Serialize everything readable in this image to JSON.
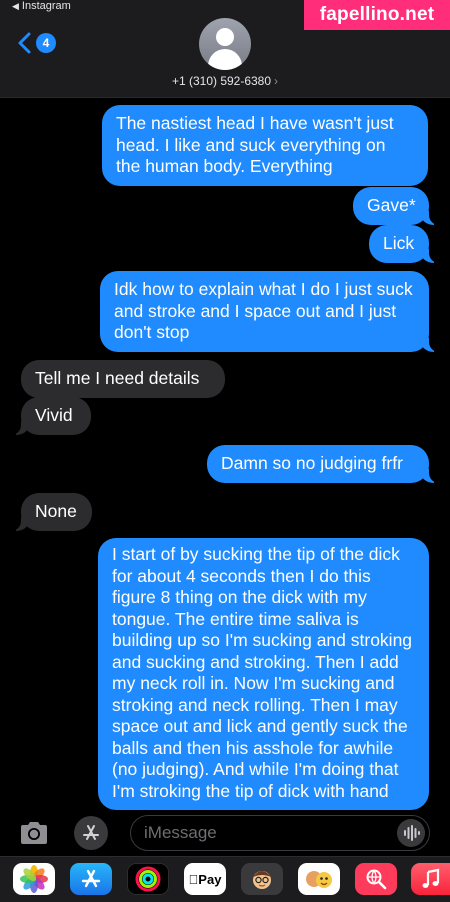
{
  "status_bar": {
    "back_app": "Instagram"
  },
  "header": {
    "back_count": "4",
    "contact_name": "+1 (310) 592-6380",
    "watermark": "fapellino.net"
  },
  "messages": [
    {
      "direction": "outgoing",
      "text": "The nastiest head I have wasn't just head. I like and suck everything on the human body. Everything"
    },
    {
      "direction": "outgoing",
      "text": "Gave*"
    },
    {
      "direction": "outgoing",
      "text": "Lick"
    },
    {
      "direction": "outgoing",
      "text": "Idk how to explain what I do I just suck and stroke and I space out and I just don't stop"
    },
    {
      "direction": "incoming",
      "text": "Tell me I need details"
    },
    {
      "direction": "incoming",
      "text": "Vivid"
    },
    {
      "direction": "outgoing",
      "text": "Damn so no judging frfr"
    },
    {
      "direction": "incoming",
      "text": "None"
    },
    {
      "direction": "outgoing",
      "text": "I start of by sucking the tip of the dick for about 4 seconds then I do this figure 8 thing on the dick with my tongue. The entire time saliva is building up so I'm sucking and stroking and sucking and stroking. Then I add my neck roll in. Now I'm sucking and stroking and neck rolling. Then I may space out and lick and gently suck the balls and then his asshole for awhile (no judging). And while I'm doing that I'm stroking the tip of dick with hand"
    }
  ],
  "input": {
    "placeholder": "iMessage"
  },
  "app_strip": [
    {
      "name": "photos",
      "icon": "photos-icon"
    },
    {
      "name": "app-store",
      "icon": "app-store-icon"
    },
    {
      "name": "activity",
      "icon": "activity-rings-icon"
    },
    {
      "name": "apple-pay",
      "icon": "apple-pay-icon",
      "label": "Pay"
    },
    {
      "name": "memoji-stickers",
      "icon": "memoji-icon"
    },
    {
      "name": "animoji",
      "icon": "animoji-icon"
    },
    {
      "name": "web-search",
      "icon": "globe-search-icon"
    },
    {
      "name": "music",
      "icon": "music-note-icon"
    }
  ],
  "colors": {
    "outgoing_bubble": "#1f8bff",
    "incoming_bubble": "#2c2c2e",
    "accent": "#1f8bff",
    "watermark": "#ff2d7a"
  }
}
